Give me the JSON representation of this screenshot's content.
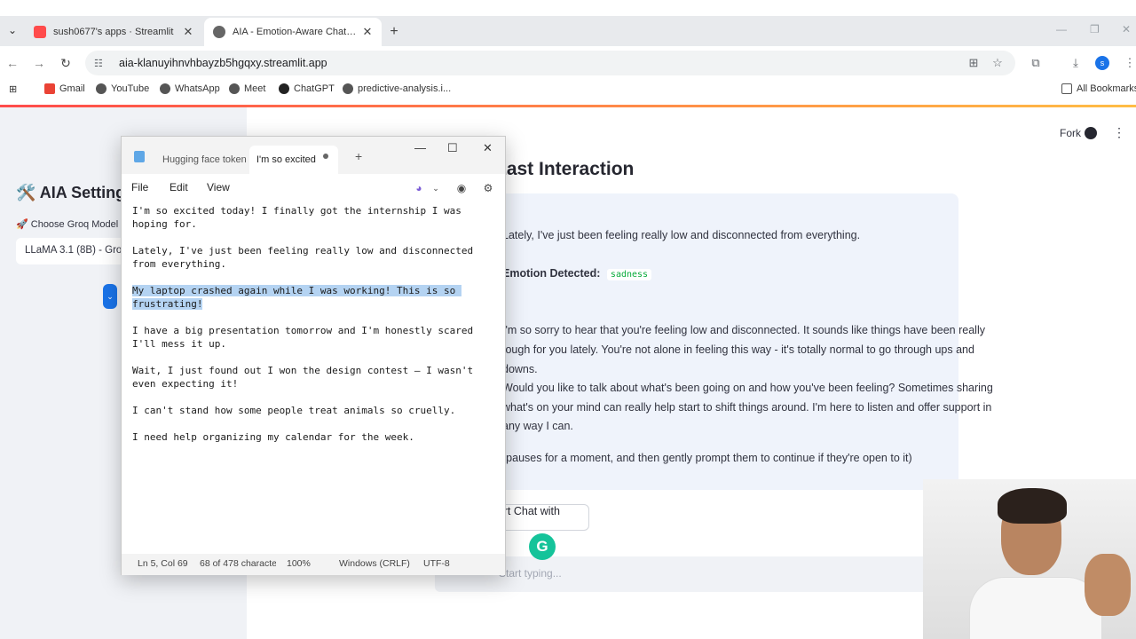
{
  "browser": {
    "tabs": [
      {
        "title": "sush0677's apps · Streamlit",
        "favicon_color": "#ff4b4b"
      },
      {
        "title": "AIA - Emotion-Aware Chatbot ·",
        "favicon_color": "#555555"
      }
    ],
    "url": "aia-klanuyihnvhbayzb5hgqxy.streamlit.app",
    "bookmarks": [
      "Gmail",
      "YouTube",
      "WhatsApp",
      "Meet",
      "ChatGPT",
      "predictive-analysis.i..."
    ],
    "all_bookmarks": "All Bookmarks",
    "profile_initial": "s"
  },
  "sidebar": {
    "title": "🛠️ AIA Settings",
    "model_label": "🚀 Choose Groq Model",
    "model_value": "LLaMA 3.1 (8B) - Groq"
  },
  "main": {
    "fork": "Fork",
    "heading": "Last Interaction",
    "user_line": "Lately, I've just been feeling really low and disconnected from everything.",
    "emotion_label": "Emotion Detected:",
    "emotion_value": "sadness",
    "reply_lines": [
      "I'm so sorry to hear that you're feeling low and disconnected. It sounds like things have been really",
      "tough for you lately. You're not alone in feeling this way - it's totally normal to go through ups and",
      "downs.",
      "Would you like to talk about what's been going on and how you've been feeling? Sometimes sharing",
      "what's on your mind can really help start to shift things around. I'm here to listen and offer support in",
      "any way I can.",
      "(pauses for a moment, and then gently prompt them to continue if they're open to it)"
    ],
    "start_button": "Start Chat with AIA",
    "chat_placeholder": "Start typing..."
  },
  "notepad": {
    "tabs": [
      "Hugging face token",
      "I'm so excited"
    ],
    "menu": [
      "File",
      "Edit",
      "View"
    ],
    "paragraphs": [
      "I'm so excited today! I finally got the internship I was hoping for.",
      "Lately, I've just been feeling really low and disconnected from everything.",
      "My laptop crashed again while I was working! This is so frustrating!",
      "I have a big presentation tomorrow and I'm honestly scared I'll mess it up.",
      "Wait, I just found out I won the design contest — I wasn't even expecting it!",
      "I can't stand how some people treat animals so cruelly.",
      "I need help organizing my calendar for the week."
    ],
    "status": {
      "position": "Ln 5, Col 69",
      "chars": "68 of 478 characte",
      "zoom": "100%",
      "line_ending": "Windows (CRLF)",
      "encoding": "UTF-8"
    }
  },
  "grammarly": "G"
}
